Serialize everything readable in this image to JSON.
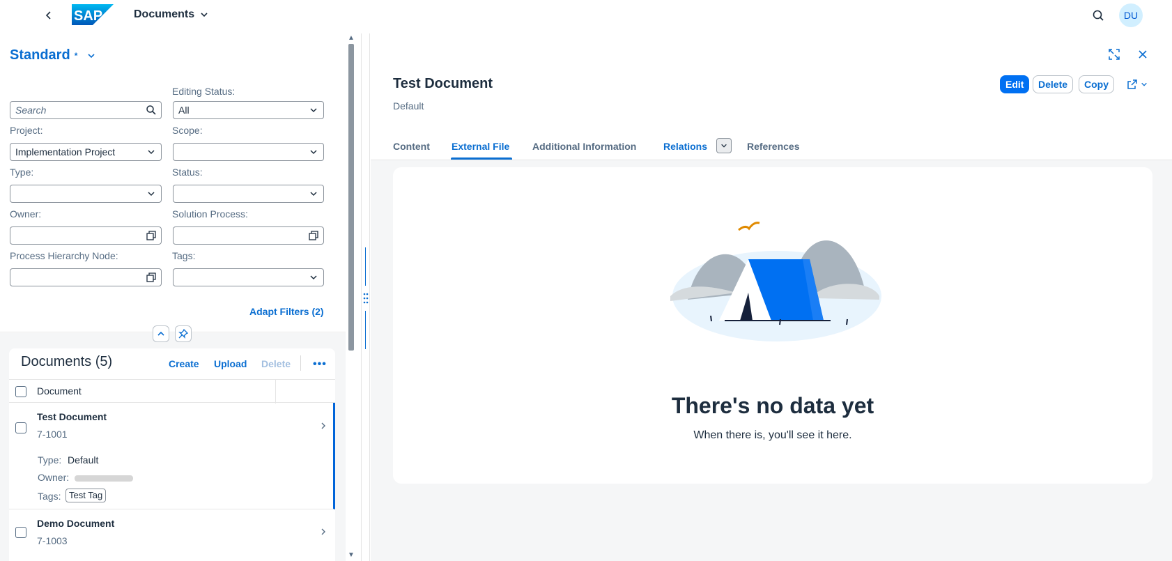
{
  "shell": {
    "title": "Documents",
    "avatar_initials": "DU",
    "logo_text": "SAP",
    "back_icon": "chevron-left-icon",
    "search_icon": "search-icon"
  },
  "filters": {
    "variant": "Standard",
    "variant_modified_marker": "*",
    "search_placeholder": "Search",
    "editing_status_label": "Editing Status:",
    "editing_status_value": "All",
    "project_label": "Project:",
    "project_value": "Implementation Project",
    "scope_label": "Scope:",
    "scope_value": "",
    "type_label": "Type:",
    "type_value": "",
    "status_label": "Status:",
    "status_value": "",
    "owner_label": "Owner:",
    "owner_value": "",
    "solution_process_label": "Solution Process:",
    "solution_process_value": "",
    "process_hierarchy_label": "Process Hierarchy Node:",
    "process_hierarchy_value": "",
    "tags_label": "Tags:",
    "tags_value": "",
    "adapt_filters": "Adapt Filters (2)"
  },
  "documents": {
    "title": "Documents (5)",
    "create": "Create",
    "upload": "Upload",
    "delete": "Delete",
    "column_document": "Document",
    "rows": [
      {
        "name": "Test Document",
        "id": "7-1001",
        "type_label": "Type:",
        "type_value": "Default",
        "owner_label": "Owner:",
        "tags_label": "Tags:",
        "tag": "Test Tag"
      },
      {
        "name": "Demo Document",
        "id": "7-1003"
      }
    ]
  },
  "detail": {
    "title": "Test Document",
    "subtitle": "Default",
    "actions": {
      "edit": "Edit",
      "delete": "Delete",
      "copy": "Copy"
    },
    "tabs": [
      "Content",
      "External File",
      "Additional Information",
      "Relations",
      "References"
    ],
    "active_tab": "External File",
    "empty_title": "There's no data yet",
    "empty_subtitle": "When there is, you'll see it here."
  },
  "colors": {
    "accent": "#0a6ed1",
    "primary_button": "#0070f2",
    "text": "#1d2d3e",
    "muted_text": "#556b82",
    "background": "#f5f6f7"
  }
}
